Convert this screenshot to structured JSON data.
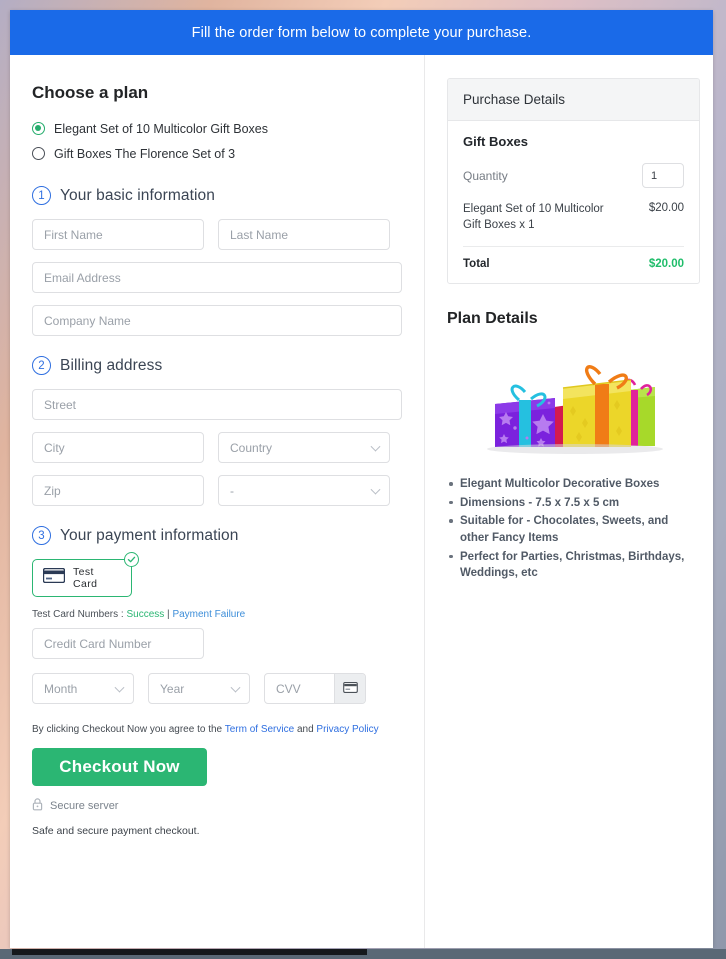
{
  "banner": {
    "text": "Fill the order form below to complete your purchase."
  },
  "plans": {
    "heading": "Choose a plan",
    "options": [
      {
        "label": "Elegant Set of 10 Multicolor Gift Boxes",
        "selected": true
      },
      {
        "label": "Gift Boxes The Florence Set of 3",
        "selected": false
      }
    ]
  },
  "steps": [
    {
      "number": "1",
      "title": "Your basic information"
    },
    {
      "number": "2",
      "title": "Billing address"
    },
    {
      "number": "3",
      "title": "Your payment information"
    }
  ],
  "basic_info": {
    "first_name": {
      "placeholder": "First Name",
      "value": ""
    },
    "last_name": {
      "placeholder": "Last Name",
      "value": ""
    },
    "email": {
      "placeholder": "Email Address",
      "value": ""
    },
    "company": {
      "placeholder": "Company Name",
      "value": ""
    }
  },
  "billing": {
    "street": {
      "placeholder": "Street",
      "value": ""
    },
    "city": {
      "placeholder": "City",
      "value": ""
    },
    "country": {
      "placeholder": "Country",
      "value": ""
    },
    "zip": {
      "placeholder": "Zip",
      "value": ""
    },
    "state": {
      "placeholder": "-",
      "value": ""
    }
  },
  "payment": {
    "method_label": "Test Card",
    "method_selected": true,
    "test_numbers_prefix": "Test Card Numbers : ",
    "link_success": "Success",
    "separator": " | ",
    "link_failure": "Payment Failure",
    "card_number": {
      "placeholder": "Credit Card Number",
      "value": ""
    },
    "month": {
      "placeholder": "Month",
      "value": ""
    },
    "year": {
      "placeholder": "Year",
      "value": ""
    },
    "cvv": {
      "placeholder": "CVV",
      "value": ""
    }
  },
  "footer": {
    "terms_prefix": "By clicking Checkout Now you agree to the ",
    "terms_link": "Term of Service",
    "terms_mid": " and ",
    "privacy_link": "Privacy Policy",
    "checkout_label": "Checkout Now",
    "secure_server": "Secure server",
    "safe_note": "Safe and secure payment checkout."
  },
  "purchase": {
    "header": "Purchase Details",
    "item_group": "Gift Boxes",
    "quantity_label": "Quantity",
    "quantity_value": "1",
    "line_item": "Elegant Set of 10 Multicolor Gift Boxes x 1",
    "line_amount": "$20.00",
    "total_label": "Total",
    "total_amount": "$20.00"
  },
  "plan_details": {
    "heading": "Plan Details",
    "image_alt": "gift-boxes-illustration",
    "bullets": [
      "Elegant Multicolor Decorative Boxes",
      "Dimensions - 7.5 x 7.5 x 5 cm",
      "Suitable for - Chocolates, Sweets, and other Fancy Items",
      "Perfect for Parties, Christmas, Birthdays, Weddings, etc"
    ]
  },
  "colors": {
    "banner_blue": "#1a6ae8",
    "accent_green": "#2bb673",
    "total_green": "#1fbd6a",
    "step_blue": "#2f6fe0",
    "link_blue": "#3d8ed9"
  }
}
